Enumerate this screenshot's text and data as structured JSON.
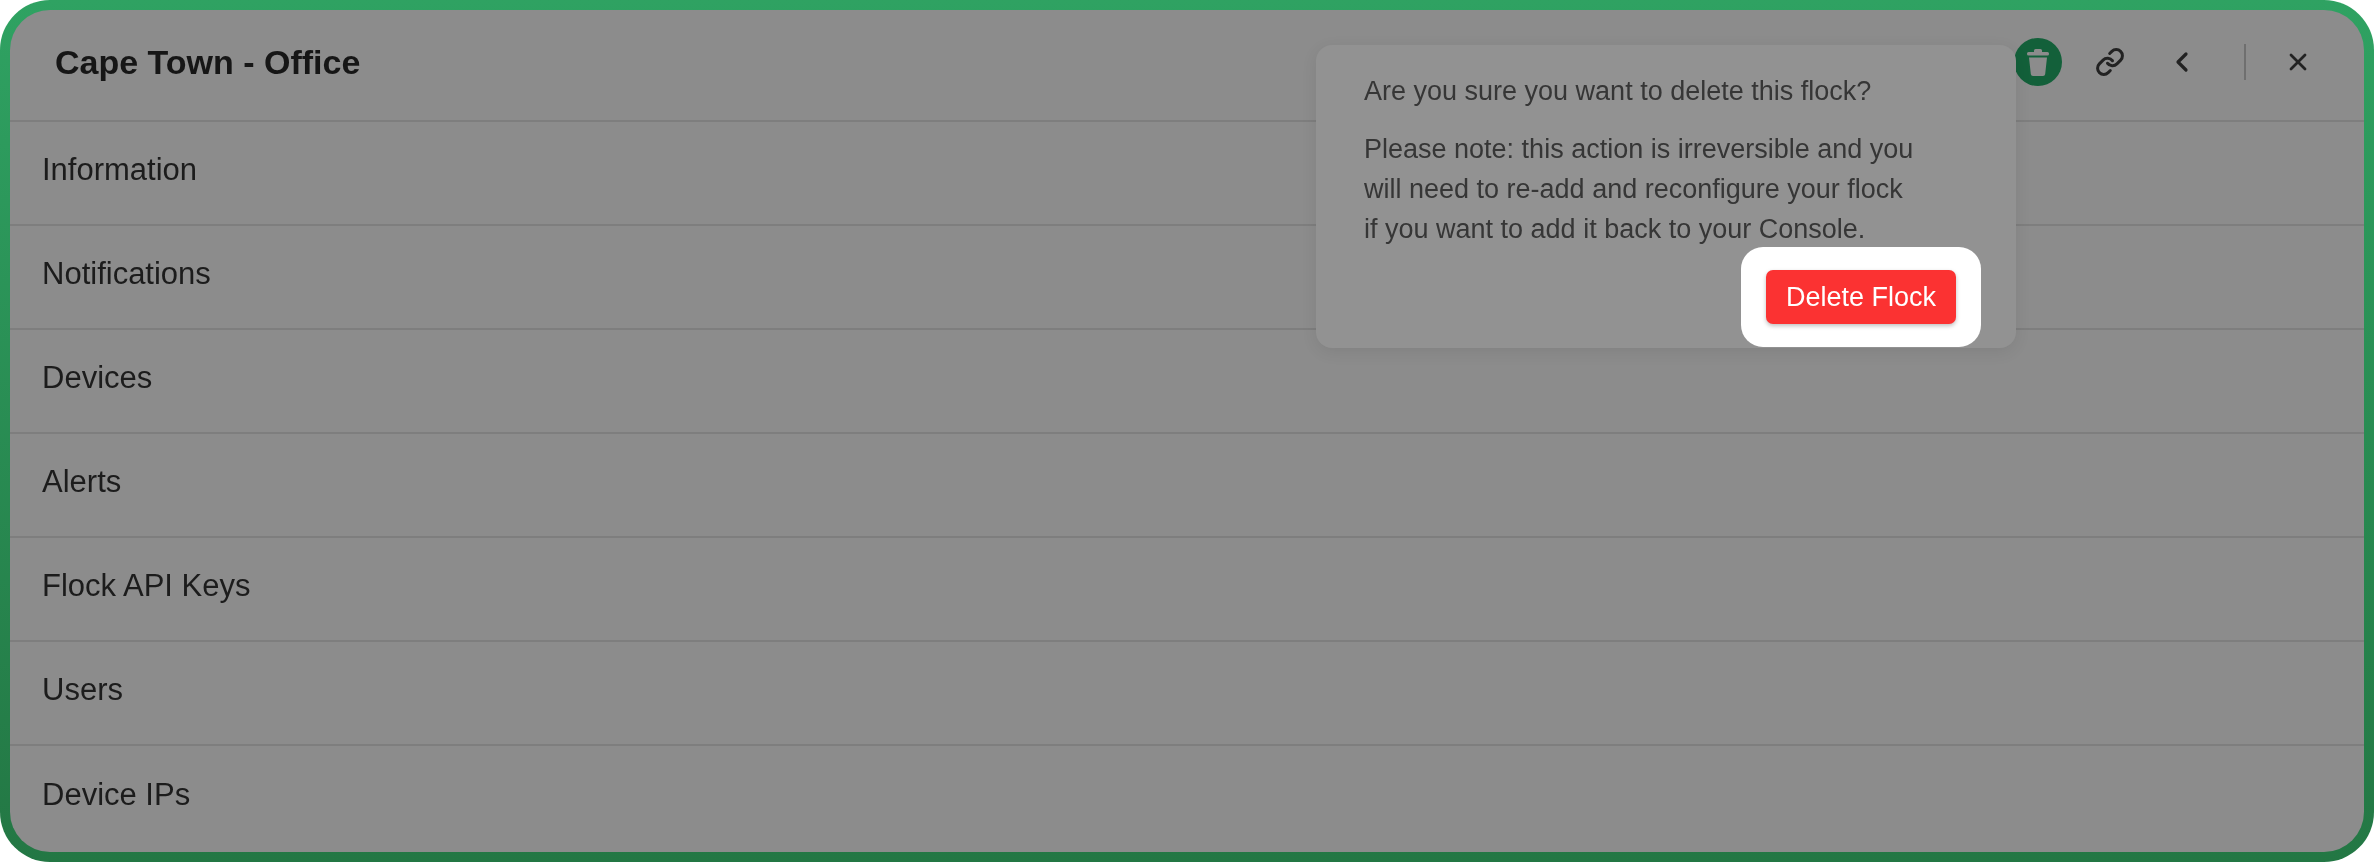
{
  "header": {
    "title": "Cape Town - Office",
    "actions": [
      {
        "kind": "delete",
        "active": true
      },
      {
        "kind": "link",
        "active": false
      },
      {
        "kind": "back",
        "active": false
      },
      {
        "kind": "close",
        "active": false
      }
    ]
  },
  "menu": {
    "items": [
      "Information",
      "Notifications",
      "Devices",
      "Alerts",
      "Flock API Keys",
      "Users",
      "Device IPs"
    ]
  },
  "confirm_popover": {
    "question": "Are you sure you want to delete this flock?",
    "note": "Please note: this action is irreversible and you will need to re-add and reconfigure your flock if you want to add it back to your Console.",
    "button": "Delete Flock",
    "spotlight": true
  }
}
